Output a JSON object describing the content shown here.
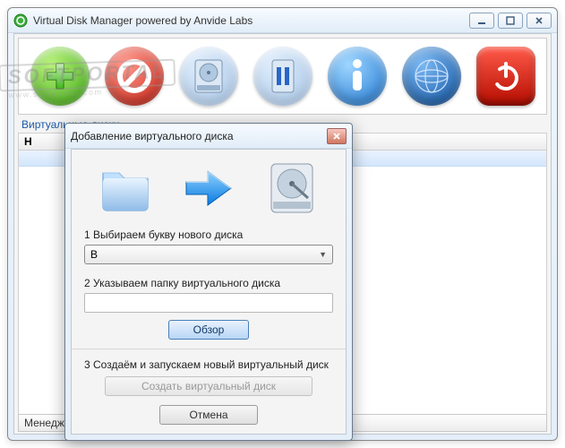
{
  "main": {
    "title": "Virtual Disk Manager   powered by Anvide Labs",
    "section_label": "Виртуальные диски",
    "column_header": "Н",
    "status_text": "Менеджер"
  },
  "toolbar": {
    "icons": [
      "add",
      "stop",
      "disk",
      "pause",
      "info",
      "globe",
      "power"
    ]
  },
  "dialog": {
    "title": "Добавление виртуального диска",
    "step1_label": "1 Выбираем букву нового диска",
    "drive_letter": "B",
    "step2_label": "2 Указываем папку виртуального диска",
    "folder_path": "",
    "browse_label": "Обзор",
    "step3_label": "3 Создаём и запускаем новый виртуальный диск",
    "create_label": "Создать виртуальный диск",
    "cancel_label": "Отмена"
  },
  "watermark": {
    "brand": "SOFTPORTAL",
    "domain": "www.softportal.com"
  }
}
